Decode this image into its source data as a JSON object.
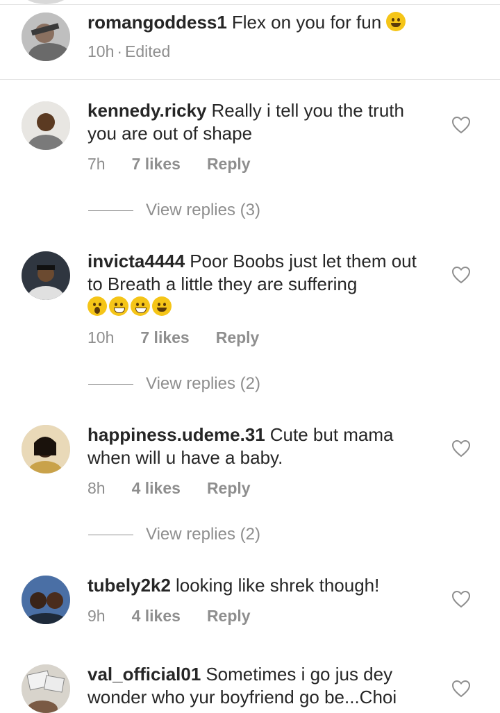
{
  "caption": {
    "username": "romangoddess1",
    "text": "Flex on you for fun",
    "emoji": "tongue-wink-emoji",
    "time": "10h",
    "separator": "·",
    "edited": "Edited"
  },
  "comments": [
    {
      "username": "kennedy.ricky",
      "text": "Really i tell you the truth you are out of shape",
      "time": "7h",
      "likes": "7 likes",
      "reply": "Reply",
      "view_replies": "View replies (3)"
    },
    {
      "username": "invicta4444",
      "text": "Poor Boobs just let them out to Breath a little they are suffering",
      "emojis": [
        "scream-emoji",
        "grin-emoji",
        "grin-emoji",
        "wink-emoji"
      ],
      "time": "10h",
      "likes": "7 likes",
      "reply": "Reply",
      "view_replies": "View replies (2)"
    },
    {
      "username": "happiness.udeme.31",
      "text": "Cute but mama when will u have a baby.",
      "time": "8h",
      "likes": "4 likes",
      "reply": "Reply",
      "view_replies": "View replies (2)"
    },
    {
      "username": "tubely2k2",
      "text": "looking like shrek though!",
      "time": "9h",
      "likes": "4 likes",
      "reply": "Reply"
    },
    {
      "username": "val_official01",
      "text": "Sometimes i go jus dey wonder who yur boyfriend go be...Choi"
    }
  ],
  "colors": {
    "text": "#262626",
    "secondary": "#8e8e8e",
    "divider": "#e6e6e6",
    "background": "#ffffff"
  }
}
